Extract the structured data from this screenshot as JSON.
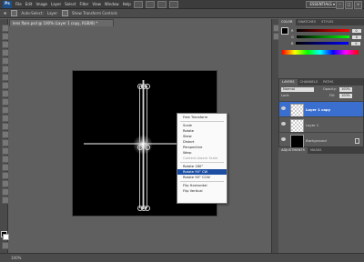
{
  "menubar": {
    "app_logo": "Ps",
    "items": [
      "File",
      "Edit",
      "Image",
      "Layer",
      "Select",
      "Filter",
      "View",
      "Window",
      "Help"
    ],
    "workspace": "ESSENTIALS ▾",
    "window_controls": [
      "–",
      "□",
      "×"
    ]
  },
  "optionsbar": {
    "items": [
      "Auto-Select:",
      "Layer",
      "Show Transform Controls"
    ]
  },
  "document": {
    "tab_title": "lens flare.psd @ 100% (Layer 1 copy, RGB/8) *"
  },
  "context_menu": {
    "items": [
      {
        "label": "Free Transform",
        "state": "normal"
      },
      {
        "sep": true
      },
      {
        "label": "Scale",
        "state": "normal"
      },
      {
        "label": "Rotate",
        "state": "normal"
      },
      {
        "label": "Skew",
        "state": "normal"
      },
      {
        "label": "Distort",
        "state": "normal"
      },
      {
        "label": "Perspective",
        "state": "normal"
      },
      {
        "label": "Warp",
        "state": "normal"
      },
      {
        "label": "Content-Aware Scale",
        "state": "disabled"
      },
      {
        "sep": true
      },
      {
        "label": "Rotate 180°",
        "state": "normal"
      },
      {
        "label": "Rotate 90° CW",
        "state": "selected"
      },
      {
        "label": "Rotate 90° CCW",
        "state": "normal"
      },
      {
        "sep": true
      },
      {
        "label": "Flip Horizontal",
        "state": "normal"
      },
      {
        "label": "Flip Vertical",
        "state": "normal"
      }
    ]
  },
  "color_panel": {
    "tabs": [
      "COLOR",
      "SWATCHES",
      "STYLES"
    ],
    "sliders": [
      {
        "label": "R",
        "value": "0",
        "color": "#ff0000"
      },
      {
        "label": "G",
        "value": "0",
        "color": "#00ff00"
      },
      {
        "label": "B",
        "value": "0",
        "color": "#0000ff"
      }
    ]
  },
  "layers_panel": {
    "tabs": [
      "LAYERS",
      "CHANNELS",
      "PATHS"
    ],
    "blend_mode": "Normal",
    "opacity_label": "Opacity:",
    "opacity": "100%",
    "lock_label": "Lock:",
    "fill_label": "Fill:",
    "fill": "100%",
    "layers": [
      {
        "name": "Layer 1 copy",
        "selected": true,
        "thumb": "checker"
      },
      {
        "name": "Layer 1",
        "selected": false,
        "thumb": "checker"
      },
      {
        "name": "Background",
        "selected": false,
        "thumb": "black",
        "italic": true
      }
    ]
  },
  "adjustments_panel": {
    "tabs": [
      "ADJUSTMENTS",
      "MASKS"
    ]
  },
  "statusbar": {
    "text": "100%"
  },
  "colors": {
    "selection_blue": "#3a6fd0",
    "menu_highlight": "#1c4fa3"
  }
}
